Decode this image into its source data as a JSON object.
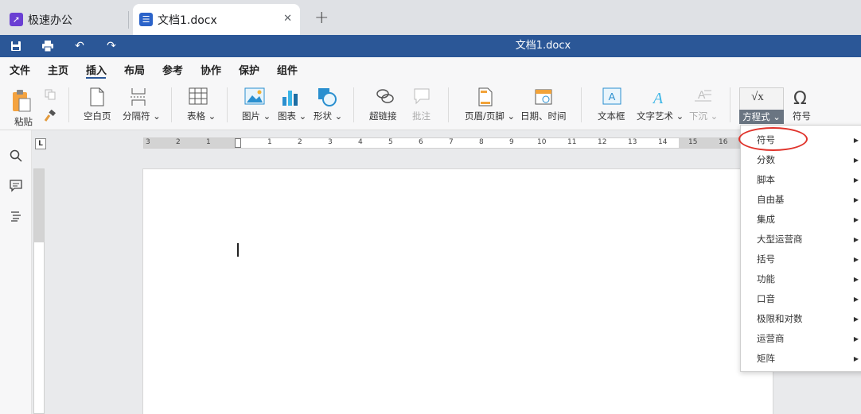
{
  "browser_tabs": [
    {
      "title": "极速办公",
      "active": false
    },
    {
      "title": "文档1.docx",
      "active": true
    }
  ],
  "titlebar": {
    "document_title": "文档1.docx"
  },
  "menu": [
    "文件",
    "主页",
    "插入",
    "布局",
    "参考",
    "协作",
    "保护",
    "组件"
  ],
  "active_menu": "插入",
  "ribbon": {
    "paste": "粘贴",
    "blank_page": "空白页",
    "separator": "分隔符",
    "table": "表格",
    "picture": "图片",
    "chart": "图表",
    "shape": "形状",
    "hyperlink": "超链接",
    "comment": "批注",
    "header_footer": "页眉/页脚",
    "date_time": "日期、时间",
    "textbox": "文本框",
    "text_art": "文字艺术",
    "drop_cap": "下沉",
    "equation": "方程式",
    "symbol": "符号",
    "equation_icon_text": "√x"
  },
  "ruler_numbers": [
    "3",
    "2",
    "1",
    "1",
    "2",
    "3",
    "4",
    "5",
    "6",
    "7",
    "8",
    "9",
    "10",
    "11",
    "12",
    "13",
    "14",
    "15",
    "16"
  ],
  "equation_dropdown": {
    "items": [
      "符号",
      "分数",
      "脚本",
      "自由基",
      "集成",
      "大型运营商",
      "括号",
      "功能",
      "口音",
      "极限和对数",
      "运营商",
      "矩阵"
    ],
    "highlighted": "符号"
  },
  "colors": {
    "title_bar": "#2b5797",
    "highlight_oval": "#e0332b"
  }
}
